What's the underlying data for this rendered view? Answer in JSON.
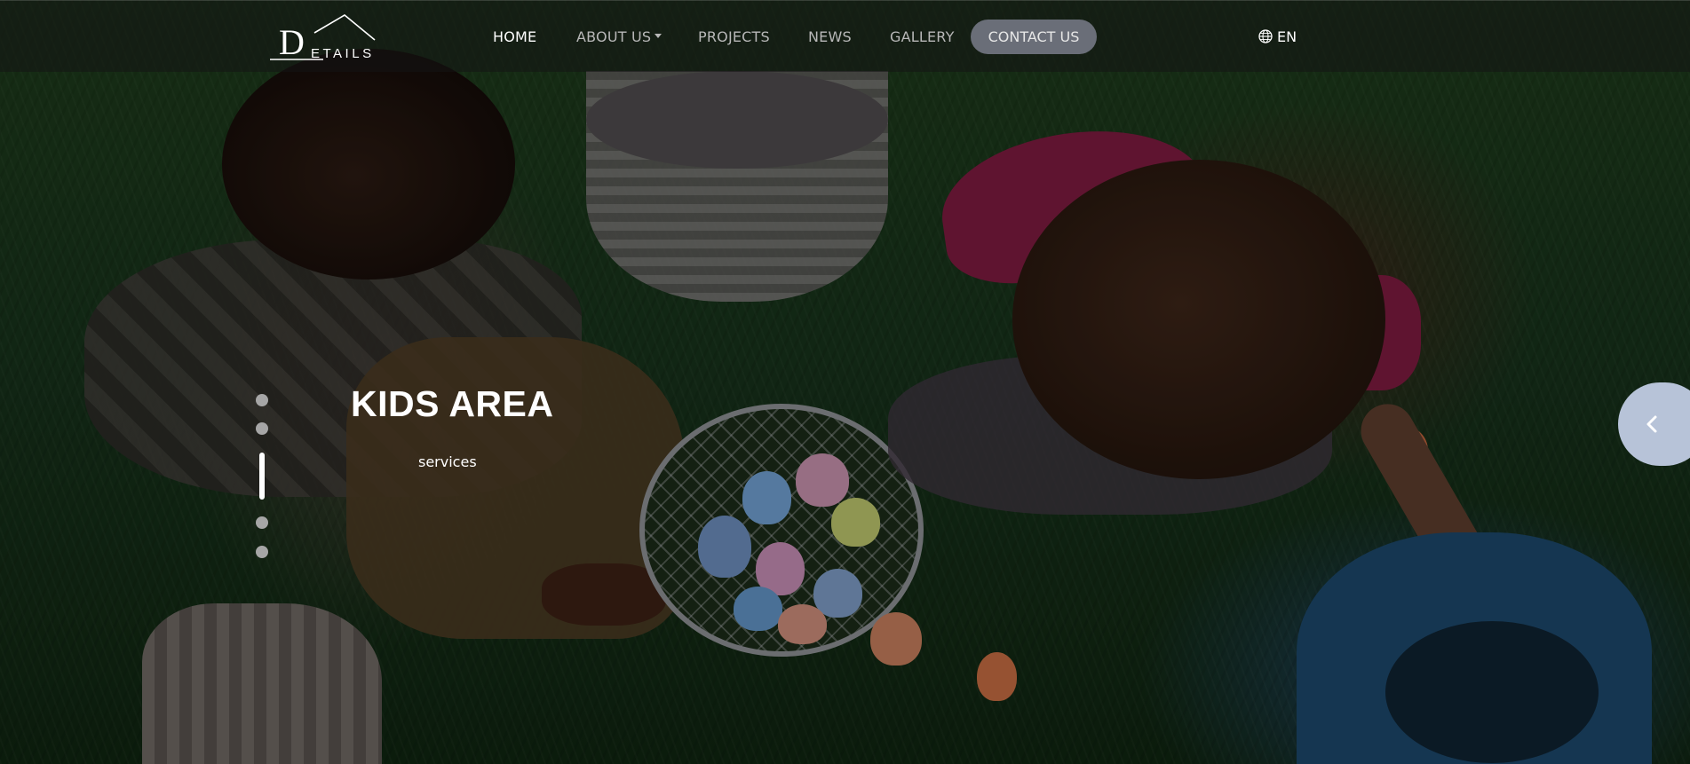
{
  "nav": {
    "logo_alt": "DETAILS",
    "items": [
      {
        "label": "HOME",
        "active": true
      },
      {
        "label": "ABOUT US",
        "has_dropdown": true
      },
      {
        "label": "PROJECTS"
      },
      {
        "label": "NEWS"
      },
      {
        "label": "GALLERY"
      }
    ],
    "contact_label": "CONTACT US",
    "language": "EN"
  },
  "hero": {
    "title": "KIDS AREA",
    "subtitle": "services",
    "slides_count": 5,
    "active_slide": 3
  },
  "colors": {
    "nav_background": "#141414",
    "contact_button": "#6a6e78",
    "side_toggle": "#b7c3d8",
    "text": "#ffffff"
  },
  "icons": {
    "language": "globe-icon",
    "side_toggle": "chevron-left-icon"
  }
}
